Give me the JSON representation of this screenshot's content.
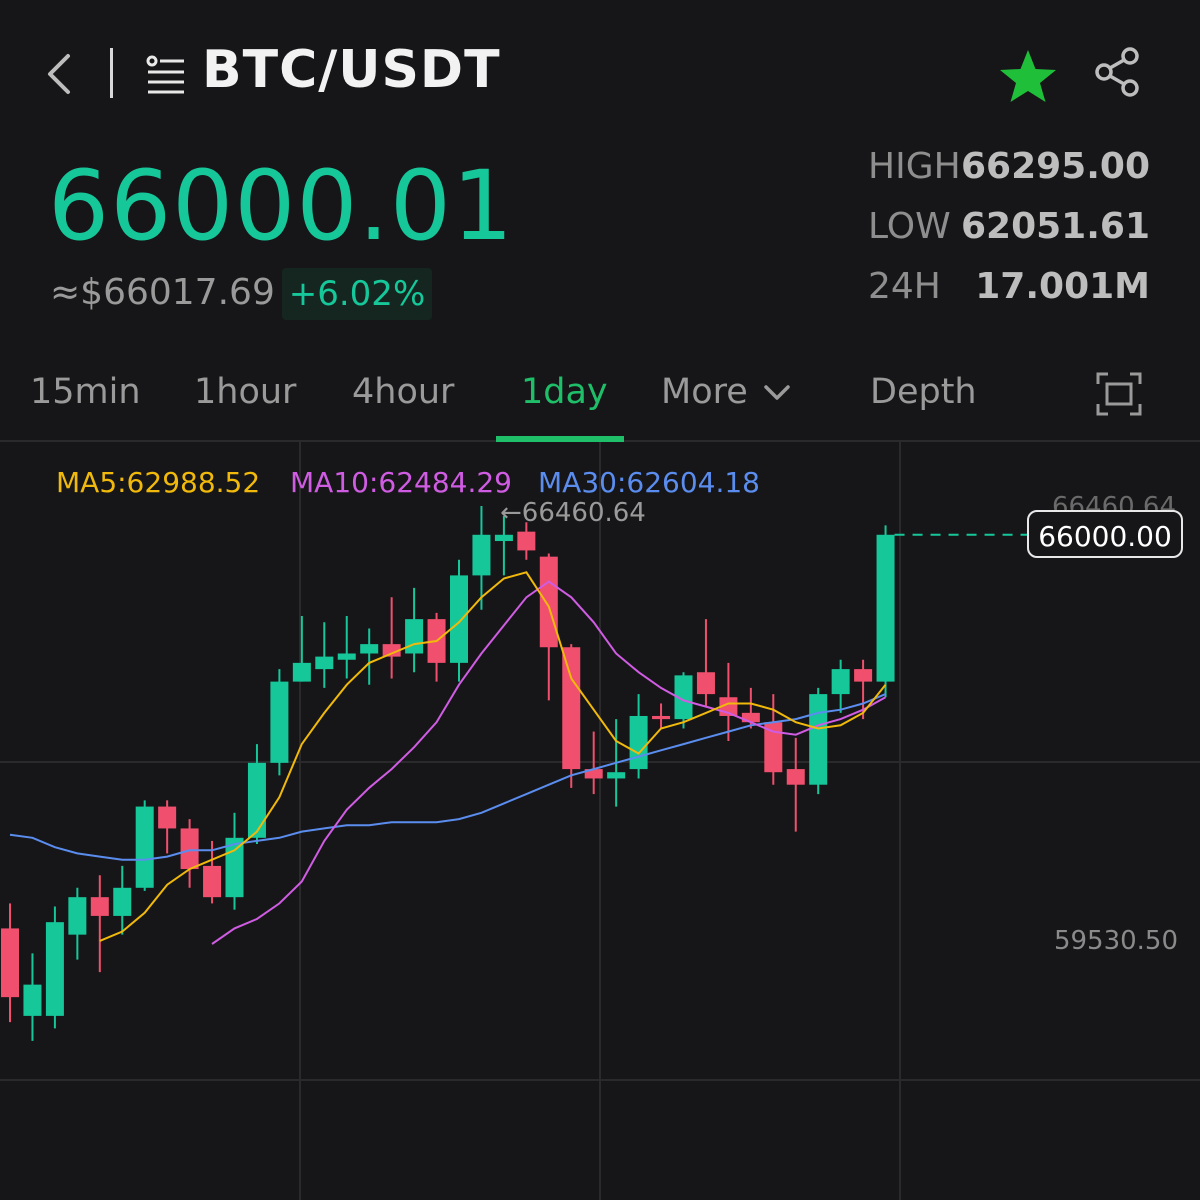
{
  "header": {
    "pair": "BTC/USDT",
    "icons": [
      "back-icon",
      "list-icon",
      "star-icon",
      "share-icon"
    ]
  },
  "price": {
    "last": "66000.01",
    "usd_approx": "≈$66017.69",
    "change": "+6.02%"
  },
  "stats": [
    {
      "label": "HIGH",
      "value": "66295.00"
    },
    {
      "label": "LOW",
      "value": "62051.61"
    },
    {
      "label": "24H",
      "value": "17.001M"
    }
  ],
  "tabs": [
    {
      "label": "15min",
      "active": false
    },
    {
      "label": "1hour",
      "active": false
    },
    {
      "label": "4hour",
      "active": false
    },
    {
      "label": "1day",
      "active": true
    },
    {
      "label": "More",
      "active": false
    },
    {
      "label": "Depth",
      "active": false
    }
  ],
  "indicators": {
    "ma5": "MA5:62988.52",
    "ma10": "MA10:62484.29",
    "ma30": "MA30:62604.18"
  },
  "chart_labels": {
    "max_marker": "←66460.64",
    "axis_top": "66460.64",
    "axis_low": "59530.50",
    "last_price": "66000.00"
  },
  "colors": {
    "up": "#16c79a",
    "down": "#f0506e",
    "ma5": "#f0b90b",
    "ma10": "#d05ce3",
    "ma30": "#5b8def",
    "active_tab": "#1fbf6a"
  },
  "chart_data": {
    "type": "candlestick",
    "price_axis": {
      "top": 66460.64,
      "bottom": 59530.5
    },
    "candles": [
      {
        "o": 59700,
        "c": 58600,
        "h": 60100,
        "l": 58200
      },
      {
        "o": 58300,
        "c": 58800,
        "h": 59300,
        "l": 57900
      },
      {
        "o": 58300,
        "c": 59800,
        "h": 60050,
        "l": 58100
      },
      {
        "o": 59600,
        "c": 60200,
        "h": 60350,
        "l": 59200
      },
      {
        "o": 60200,
        "c": 59900,
        "h": 60550,
        "l": 59000
      },
      {
        "o": 59900,
        "c": 60350,
        "h": 60700,
        "l": 59600
      },
      {
        "o": 60350,
        "c": 61650,
        "h": 61750,
        "l": 60300
      },
      {
        "o": 61650,
        "c": 61300,
        "h": 61750,
        "l": 60900
      },
      {
        "o": 61300,
        "c": 60650,
        "h": 61450,
        "l": 60350
      },
      {
        "o": 60700,
        "c": 60200,
        "h": 61100,
        "l": 60100
      },
      {
        "o": 60200,
        "c": 61150,
        "h": 61550,
        "l": 60000
      },
      {
        "o": 61150,
        "c": 62350,
        "h": 62650,
        "l": 61050
      },
      {
        "o": 62350,
        "c": 63650,
        "h": 63850,
        "l": 62150
      },
      {
        "o": 63650,
        "c": 63950,
        "h": 64700,
        "l": 63650
      },
      {
        "o": 63850,
        "c": 64050,
        "h": 64600,
        "l": 63550
      },
      {
        "o": 64000,
        "c": 64100,
        "h": 64700,
        "l": 63700
      },
      {
        "o": 64100,
        "c": 64250,
        "h": 64500,
        "l": 63600
      },
      {
        "o": 64250,
        "c": 64050,
        "h": 65000,
        "l": 63700
      },
      {
        "o": 64100,
        "c": 64650,
        "h": 65150,
        "l": 63800
      },
      {
        "o": 64650,
        "c": 63950,
        "h": 64750,
        "l": 63650
      },
      {
        "o": 63950,
        "c": 65350,
        "h": 65600,
        "l": 63650
      },
      {
        "o": 65350,
        "c": 66000,
        "h": 66460.64,
        "l": 64800
      },
      {
        "o": 65900,
        "c": 66000,
        "h": 66300,
        "l": 65350
      },
      {
        "o": 66050,
        "c": 65750,
        "h": 66200,
        "l": 65600
      },
      {
        "o": 65650,
        "c": 64200,
        "h": 65700,
        "l": 63350
      },
      {
        "o": 64200,
        "c": 62250,
        "h": 64250,
        "l": 61950
      },
      {
        "o": 62250,
        "c": 62100,
        "h": 62850,
        "l": 61850
      },
      {
        "o": 62100,
        "c": 62200,
        "h": 63050,
        "l": 61650
      },
      {
        "o": 62250,
        "c": 63100,
        "h": 63450,
        "l": 62100
      },
      {
        "o": 63100,
        "c": 63050,
        "h": 63300,
        "l": 62900
      },
      {
        "o": 63050,
        "c": 63750,
        "h": 63800,
        "l": 62900
      },
      {
        "o": 63800,
        "c": 63450,
        "h": 64650,
        "l": 63250
      },
      {
        "o": 63400,
        "c": 63100,
        "h": 63950,
        "l": 62700
      },
      {
        "o": 63150,
        "c": 63000,
        "h": 63550,
        "l": 62900
      },
      {
        "o": 63000,
        "c": 62200,
        "h": 63450,
        "l": 62000
      },
      {
        "o": 62250,
        "c": 62000,
        "h": 62750,
        "l": 61250
      },
      {
        "o": 62000,
        "c": 63450,
        "h": 63550,
        "l": 61850
      },
      {
        "o": 63450,
        "c": 63850,
        "h": 64000,
        "l": 63150
      },
      {
        "o": 63850,
        "c": 63650,
        "h": 64000,
        "l": 63050
      },
      {
        "o": 63650,
        "c": 66000,
        "h": 66150,
        "l": 63400
      }
    ],
    "ma5": [
      null,
      null,
      null,
      null,
      59500,
      59650,
      59950,
      60400,
      60650,
      60800,
      60950,
      61250,
      61800,
      62650,
      63150,
      63600,
      63950,
      64100,
      64250,
      64300,
      64600,
      65000,
      65300,
      65400,
      64850,
      63700,
      63200,
      62700,
      62500,
      62900,
      63000,
      63150,
      63300,
      63300,
      63200,
      63000,
      62900,
      62950,
      63150,
      63600
    ],
    "ma10": [
      null,
      null,
      null,
      null,
      null,
      null,
      null,
      null,
      null,
      59450,
      59700,
      59850,
      60100,
      60450,
      61100,
      61600,
      61950,
      62250,
      62600,
      63000,
      63600,
      64100,
      64550,
      65000,
      65250,
      65000,
      64600,
      64100,
      63800,
      63550,
      63350,
      63250,
      63150,
      63000,
      62850,
      62800,
      62950,
      63050,
      63200,
      63400
    ],
    "ma30": [
      61200,
      61150,
      61000,
      60900,
      60850,
      60800,
      60800,
      60850,
      60950,
      60950,
      61050,
      61100,
      61150,
      61250,
      61300,
      61350,
      61350,
      61400,
      61400,
      61400,
      61450,
      61550,
      61700,
      61850,
      62000,
      62150,
      62250,
      62350,
      62450,
      62550,
      62650,
      62750,
      62850,
      62950,
      63000,
      63050,
      63150,
      63200,
      63300,
      63450
    ]
  }
}
